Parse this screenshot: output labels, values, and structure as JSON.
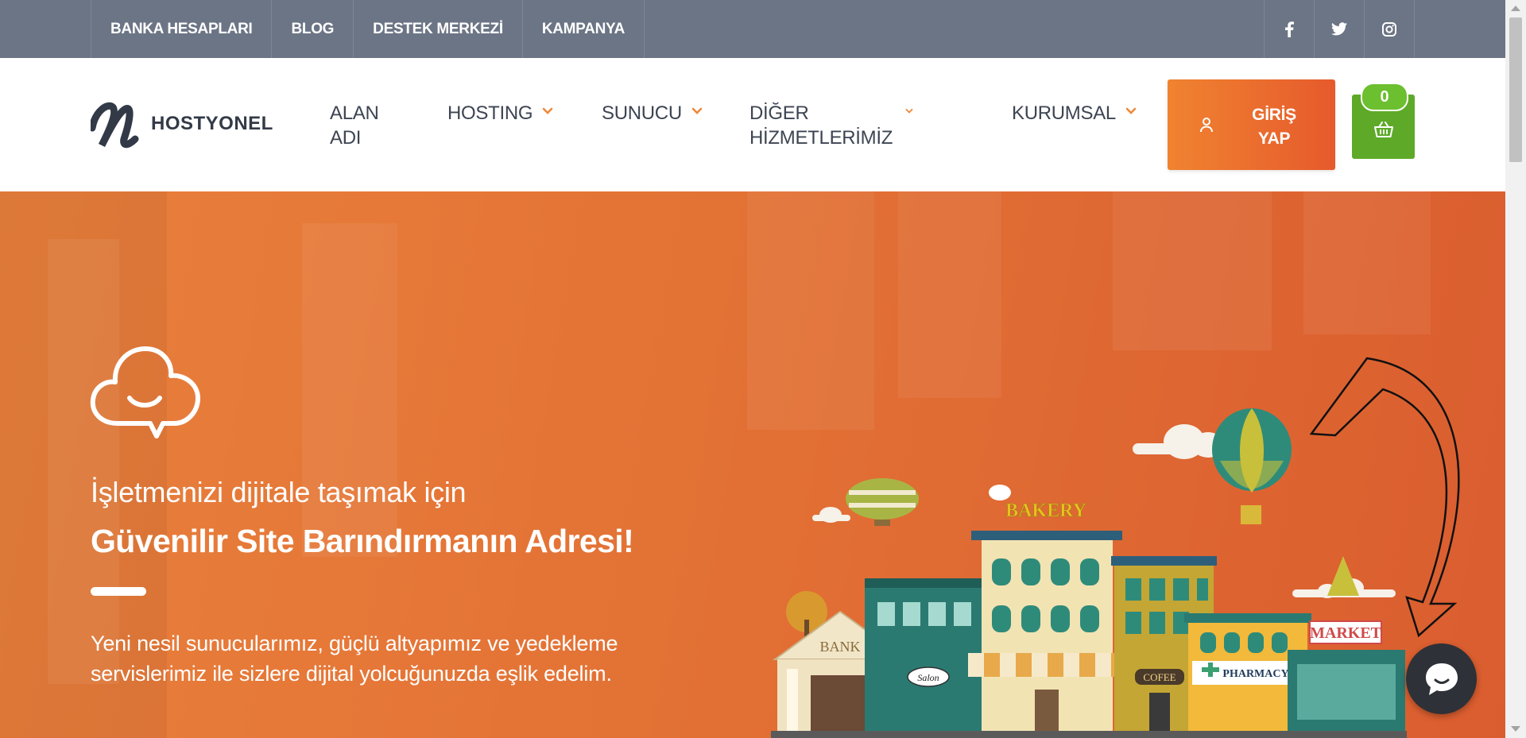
{
  "topbar": {
    "links": [
      "BANKA HESAPLARI",
      "BLOG",
      "DESTEK MERKEZİ",
      "KAMPANYA"
    ],
    "social": [
      "facebook-icon",
      "twitter-icon",
      "instagram-icon"
    ]
  },
  "brand": {
    "name": "HOSTYONEL"
  },
  "nav": {
    "alan_adi_line1": "ALAN",
    "alan_adi_line2": "ADI",
    "hosting": "HOSTING",
    "sunucu": "SUNUCU",
    "diger": "DİĞER HİZMETLERİMİZ",
    "kurumsal": "KURUMSAL"
  },
  "login": {
    "line1": "GİRİŞ",
    "line2": "YAP"
  },
  "cart": {
    "count": "0"
  },
  "hero": {
    "tagline": "İşletmenizi dijitale taşımak için",
    "headline": "Güvenilir Site Barındırmanın Adresi!",
    "desc_line1": "Yeni nesil sunucularımız, güçlü altyapımız ve yedekleme",
    "desc_line2": "servislerimiz ile sizlere dijital yolcuğunuzda eşlik edelim.",
    "signs": {
      "bakery": "BAKERY",
      "bank": "BANK",
      "salon": "Salon",
      "coffee": "COFEE",
      "pharmacy": "PHARMACY",
      "market": "MARKET"
    }
  },
  "colors": {
    "topbar": "#6c7585",
    "accent_orange": "#e65a2c",
    "cart_green": "#5eaa28",
    "hero_orange": "#e37235",
    "nav_text": "#3d4452"
  }
}
